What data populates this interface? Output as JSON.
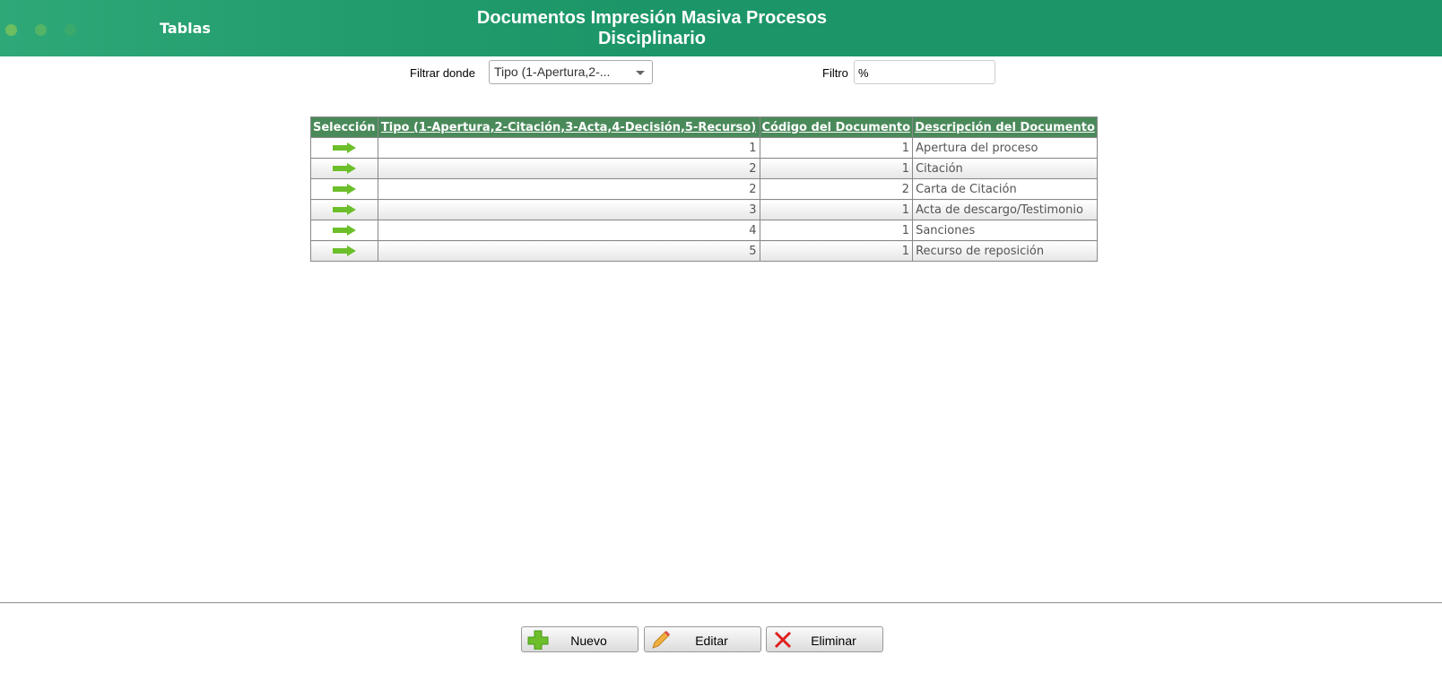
{
  "header": {
    "app": "Tablas",
    "title_line1": "Documentos Impresión Masiva Procesos",
    "title_line2": "Disciplinario",
    "accent": "#1c9668"
  },
  "filter": {
    "label": "Filtrar donde",
    "selected": "Tipo (1-Apertura,2-...",
    "filter_label": "Filtro",
    "filter_value": "%"
  },
  "table": {
    "columns": [
      "Selección",
      "Tipo (1-Apertura,2-Citación,3-Acta,4-Decisión,5-Recurso)",
      "Código del Documento",
      "Descripción del Documento"
    ],
    "rows": [
      {
        "tipo": "1",
        "codigo": "1",
        "descripcion": "Apertura del proceso"
      },
      {
        "tipo": "2",
        "codigo": "1",
        "descripcion": "Citación"
      },
      {
        "tipo": "2",
        "codigo": "2",
        "descripcion": "Carta de Citación"
      },
      {
        "tipo": "3",
        "codigo": "1",
        "descripcion": "Acta de descargo/Testimonio"
      },
      {
        "tipo": "4",
        "codigo": "1",
        "descripcion": "Sanciones"
      },
      {
        "tipo": "5",
        "codigo": "1",
        "descripcion": "Recurso de reposición"
      }
    ]
  },
  "buttons": {
    "new": "Nuevo",
    "edit": "Editar",
    "delete": "Eliminar"
  }
}
